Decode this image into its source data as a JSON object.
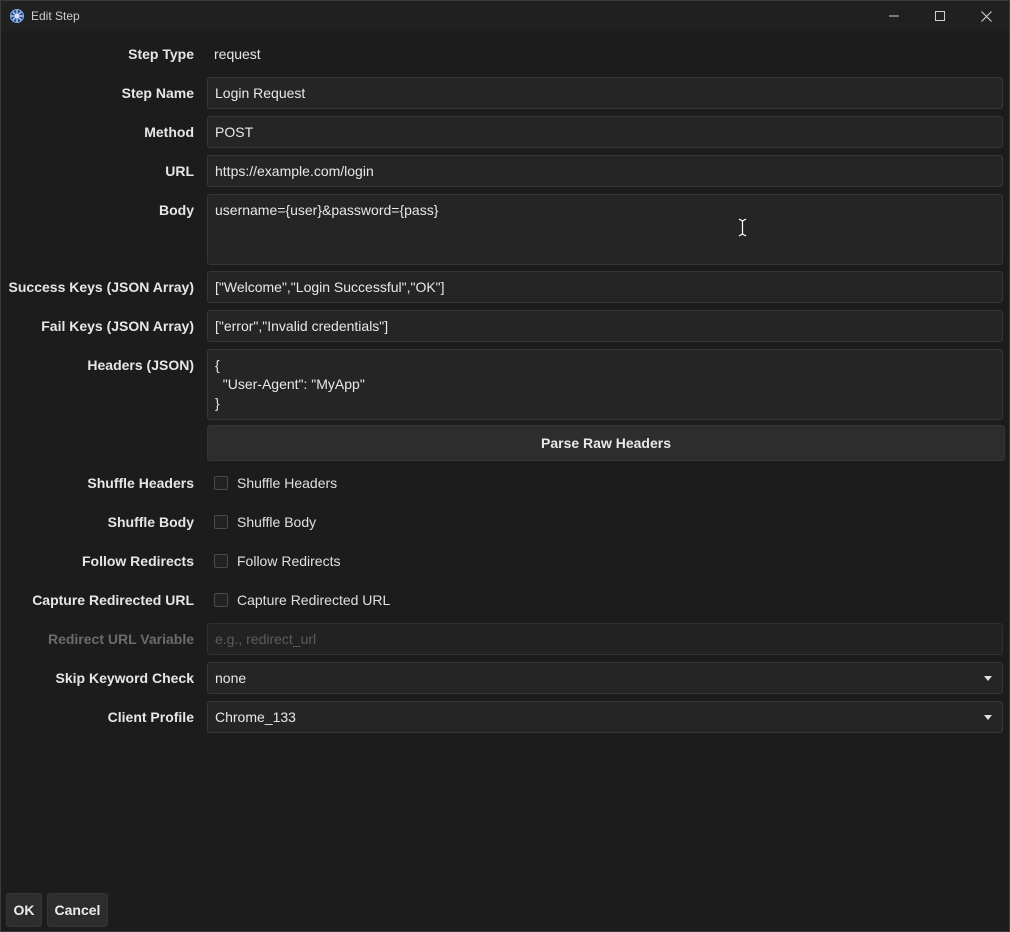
{
  "window": {
    "title": "Edit Step"
  },
  "fields": {
    "step_type": {
      "label": "Step Type",
      "value": "request"
    },
    "step_name": {
      "label": "Step Name",
      "value": "Login Request"
    },
    "method": {
      "label": "Method",
      "value": "POST"
    },
    "url": {
      "label": "URL",
      "value": "https://example.com/login"
    },
    "body": {
      "label": "Body",
      "value": "username={user}&password={pass}"
    },
    "success_keys": {
      "label": "Success Keys (JSON Array)",
      "value": "[\"Welcome\",\"Login Successful\",\"OK\"]"
    },
    "fail_keys": {
      "label": "Fail Keys (JSON Array)",
      "value": "[\"error\",\"Invalid credentials\"]"
    },
    "headers": {
      "label": "Headers (JSON)",
      "value": "{\n  \"User-Agent\": \"MyApp\"\n}"
    },
    "parse_raw_headers": "Parse Raw Headers",
    "shuffle_headers": {
      "label": "Shuffle Headers",
      "checkbox_label": "Shuffle Headers",
      "checked": false
    },
    "shuffle_body": {
      "label": "Shuffle Body",
      "checkbox_label": "Shuffle Body",
      "checked": false
    },
    "follow_redirects": {
      "label": "Follow Redirects",
      "checkbox_label": "Follow Redirects",
      "checked": false
    },
    "capture_redirected_url": {
      "label": "Capture Redirected URL",
      "checkbox_label": "Capture Redirected URL",
      "checked": false
    },
    "redirect_url_variable": {
      "label": "Redirect URL Variable",
      "placeholder": "e.g., redirect_url"
    },
    "skip_keyword_check": {
      "label": "Skip Keyword Check",
      "value": "none"
    },
    "client_profile": {
      "label": "Client Profile",
      "value": "Chrome_133"
    }
  },
  "buttons": {
    "ok": "OK",
    "cancel": "Cancel"
  },
  "colors": {
    "background": "#1c1c1c",
    "field_bg": "#252525",
    "button_bg": "#2d2d2d",
    "text": "#e8e8e8",
    "disabled_text": "#6b6b6b"
  }
}
